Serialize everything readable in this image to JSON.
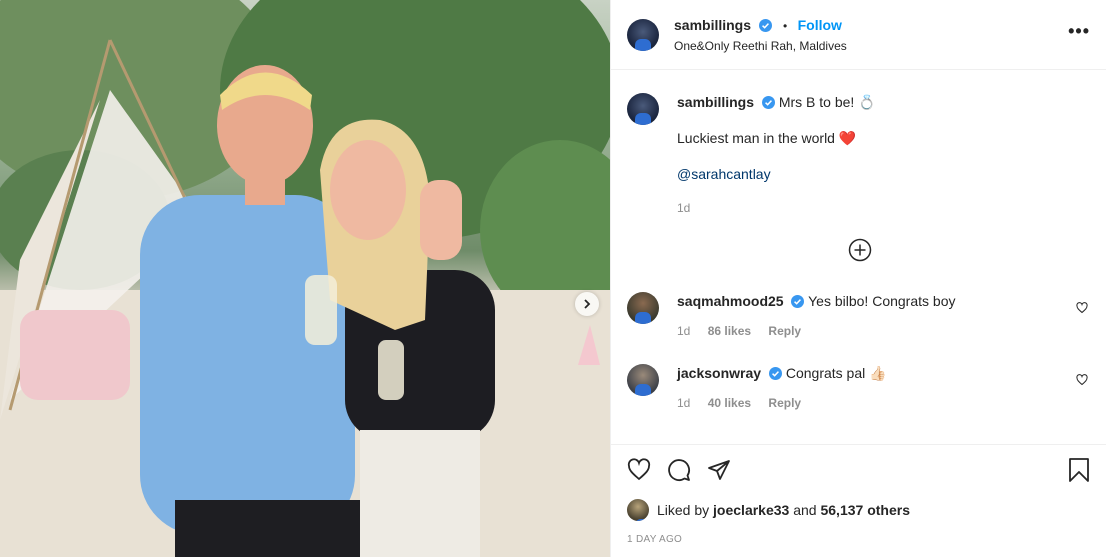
{
  "post": {
    "username": "sambillings",
    "follow_label": "Follow",
    "dot": "•",
    "location": "One&Only Reethi Rah, Maldives",
    "more": "•••"
  },
  "caption": {
    "username": "sambillings",
    "text1": "Mrs B to be! 💍",
    "text2": "Luckiest man in the world ❤️",
    "mention": "@sarahcantlay",
    "time": "1d"
  },
  "comments": [
    {
      "username": "saqmahmood25",
      "text": "Yes bilbo! Congrats boy",
      "time": "1d",
      "likes": "86 likes",
      "reply": "Reply"
    },
    {
      "username": "jacksonwray",
      "text": "Congrats pal 👍🏻",
      "time": "1d",
      "likes": "40 likes",
      "reply": "Reply"
    }
  ],
  "likes": {
    "prefix": "Liked by",
    "user": "joeclarke33",
    "and": "and",
    "others": "56,137 others"
  },
  "date": "1 DAY AGO",
  "colors": {
    "accent": "#0095f6",
    "mention": "#00376b",
    "heart": "#ed4956",
    "muted": "#8e8e8e"
  }
}
